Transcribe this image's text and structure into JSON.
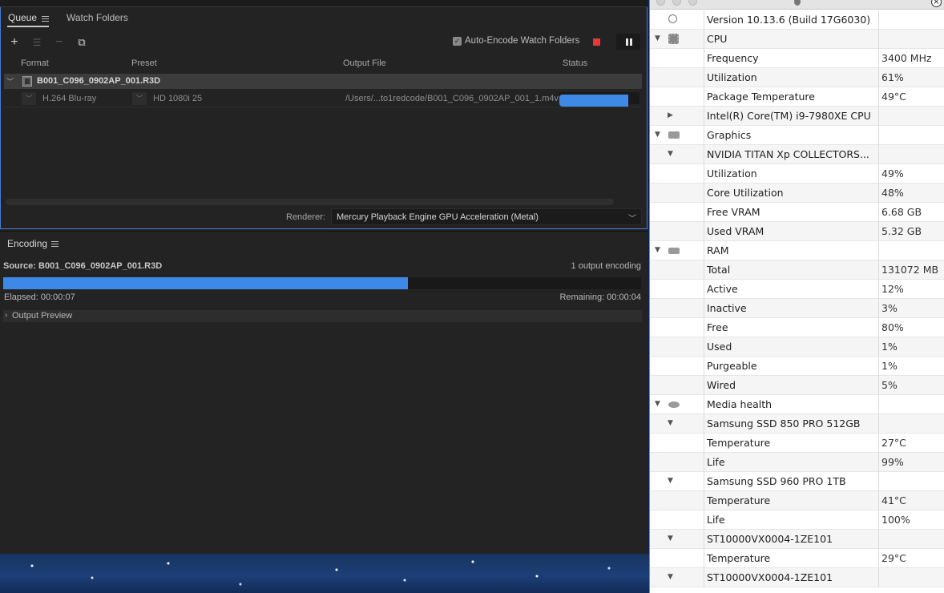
{
  "queue": {
    "tabs": [
      "Queue",
      "Watch Folders"
    ],
    "auto_encode_label": "Auto-Encode Watch Folders",
    "auto_encode_checked": true,
    "columns": [
      "Format",
      "Preset",
      "Output File",
      "Status"
    ],
    "job": {
      "source": "B001_C096_0902AP_001.R3D",
      "format": "H.264 Blu-ray",
      "preset": "HD 1080i 25",
      "output_file": "/Users/...to1redcode/B001_C096_0902AP_001_1.m4v",
      "status_progress": 0.86
    },
    "renderer_label": "Renderer:",
    "renderer_value": "Mercury Playback Engine GPU Acceleration (Metal)"
  },
  "encoding": {
    "title": "Encoding",
    "source_label": "Source:",
    "source_value": "B001_C096_0902AP_001.R3D",
    "output_count": "1 output encoding",
    "progress": 0.635,
    "elapsed": "Elapsed: 00:00:07",
    "remaining": "Remaining: 00:00:04",
    "output_preview": "Output Preview"
  },
  "stats": {
    "rows": [
      {
        "level": 0,
        "icon": "apple-icon",
        "label": "Version 10.13.6 (Build 17G6030)",
        "value": ""
      },
      {
        "level": 0,
        "toggle": "open",
        "icon": "cpu-icon",
        "label": "CPU",
        "value": ""
      },
      {
        "level": 2,
        "label": "Frequency",
        "value": "3400 MHz"
      },
      {
        "level": 2,
        "label": "Utilization",
        "value": "61%"
      },
      {
        "level": 2,
        "label": "Package Temperature",
        "value": "49°C"
      },
      {
        "level": 1,
        "toggle": "closed",
        "label": "Intel(R) Core(TM) i9-7980XE CPU",
        "value": ""
      },
      {
        "level": 0,
        "toggle": "open",
        "icon": "gpu-icon",
        "label": "Graphics",
        "value": ""
      },
      {
        "level": 1,
        "toggle": "open",
        "label": "NVIDIA TITAN Xp COLLECTORS...",
        "value": ""
      },
      {
        "level": 2,
        "label": "Utilization",
        "value": "49%"
      },
      {
        "level": 2,
        "label": "Core Utilization",
        "value": "48%"
      },
      {
        "level": 2,
        "label": "Free VRAM",
        "value": "6.68 GB"
      },
      {
        "level": 2,
        "label": "Used VRAM",
        "value": "5.32 GB"
      },
      {
        "level": 0,
        "toggle": "open",
        "icon": "ram-icon",
        "label": "RAM",
        "value": ""
      },
      {
        "level": 2,
        "label": "Total",
        "value": "131072 MB"
      },
      {
        "level": 2,
        "label": "Active",
        "value": "12%"
      },
      {
        "level": 2,
        "label": "Inactive",
        "value": "3%"
      },
      {
        "level": 2,
        "label": "Free",
        "value": "80%"
      },
      {
        "level": 2,
        "label": "Used",
        "value": "1%"
      },
      {
        "level": 2,
        "label": "Purgeable",
        "value": "1%"
      },
      {
        "level": 2,
        "label": "Wired",
        "value": "5%"
      },
      {
        "level": 0,
        "toggle": "open",
        "icon": "disk-icon",
        "label": "Media health",
        "value": ""
      },
      {
        "level": 1,
        "toggle": "open",
        "label": "Samsung SSD 850 PRO 512GB",
        "value": ""
      },
      {
        "level": 2,
        "label": "Temperature",
        "value": "27°C"
      },
      {
        "level": 2,
        "label": "Life",
        "value": "99%"
      },
      {
        "level": 1,
        "toggle": "open",
        "label": "Samsung SSD 960 PRO 1TB",
        "value": ""
      },
      {
        "level": 2,
        "label": "Temperature",
        "value": "41°C"
      },
      {
        "level": 2,
        "label": "Life",
        "value": "100%"
      },
      {
        "level": 1,
        "toggle": "open",
        "label": "ST10000VX0004-1ZE101",
        "value": ""
      },
      {
        "level": 2,
        "label": "Temperature",
        "value": "29°C"
      },
      {
        "level": 1,
        "toggle": "open",
        "label": "ST10000VX0004-1ZE101",
        "value": ""
      }
    ]
  }
}
